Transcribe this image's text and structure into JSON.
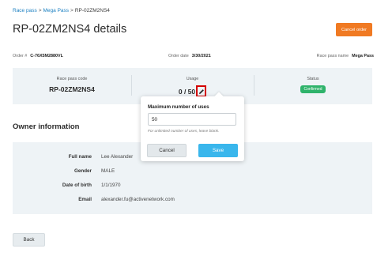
{
  "breadcrumb": {
    "items": [
      "Race pass",
      "Mega Pass",
      "RP-02ZM2NS4"
    ],
    "separator": ">"
  },
  "page": {
    "title": "RP-02ZM2NS4 details"
  },
  "header": {
    "cancel_order_label": "Cancel order"
  },
  "meta": {
    "order_label": "Order #",
    "order_value": "C-76X5M2880VL",
    "date_label": "Order date",
    "date_value": "3/30/2021",
    "name_label": "Race pass name",
    "name_value": "Mega Pass"
  },
  "summary": {
    "code_label": "Race pass code",
    "code_value": "RP-02ZM2NS4",
    "usage_label": "Usage",
    "usage_value": "0 / 50",
    "status_label": "Status",
    "status_value": "Confirmed"
  },
  "owner": {
    "section_title": "Owner information",
    "rows": [
      {
        "label": "Full name",
        "value": "Lee Alexander"
      },
      {
        "label": "Gender",
        "value": "MALE"
      },
      {
        "label": "Date of birth",
        "value": "1/1/1970"
      },
      {
        "label": "Email",
        "value": "alexander.fu@activenetwork.com"
      }
    ]
  },
  "popover": {
    "label": "Maximum number of uses",
    "input_value": "50",
    "hint": "For unlimited number of uses, leave blank.",
    "cancel_label": "Cancel",
    "save_label": "Save"
  },
  "footer": {
    "back_label": "Back"
  },
  "colors": {
    "accent_orange": "#f07a23",
    "save_blue": "#39b6ec",
    "status_green": "#2fb36b",
    "link_blue": "#1a7fc1",
    "panel_bg": "#eef3f6",
    "highlight_red": "#d40000"
  },
  "icons": {
    "edit": "pencil-icon"
  }
}
